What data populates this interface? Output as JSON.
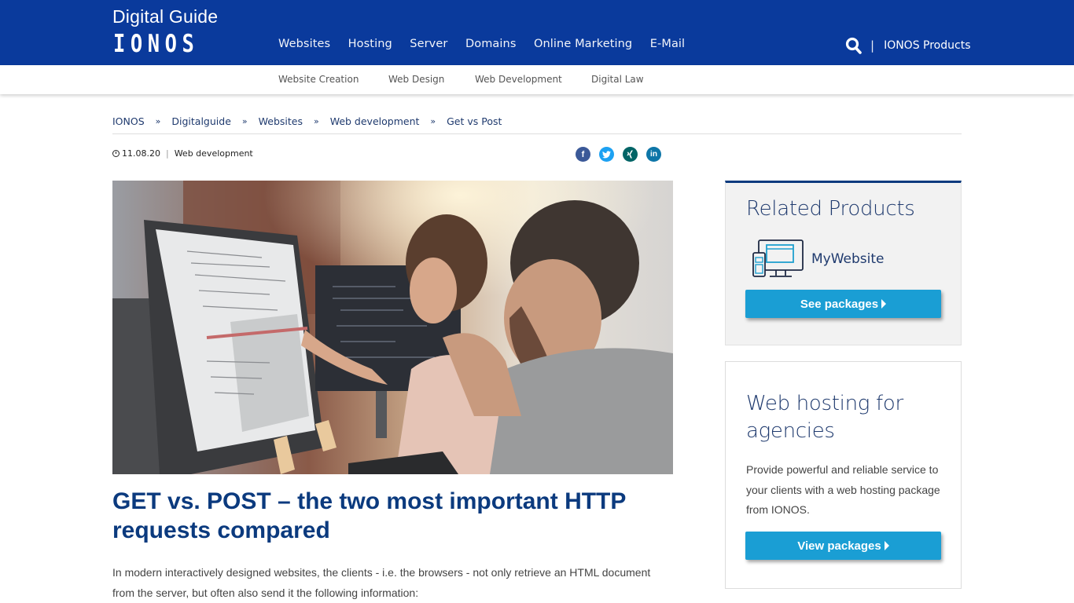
{
  "header": {
    "site_title": "Digital Guide",
    "logo": "IONOS",
    "nav": [
      "Websites",
      "Hosting",
      "Server",
      "Domains",
      "Online Marketing",
      "E-Mail"
    ],
    "search_icon": "search-icon",
    "separator": "|",
    "products_link": "IONOS Products",
    "bg_color": "#0a3a9c"
  },
  "subnav": [
    "Website Creation",
    "Web Design",
    "Web Development",
    "Digital Law"
  ],
  "breadcrumb": {
    "items": [
      "IONOS",
      "Digitalguide",
      "Websites",
      "Web development",
      "Get vs Post"
    ],
    "separator": "»"
  },
  "meta": {
    "date": "11.08.20",
    "separator": "|",
    "category": "Web development"
  },
  "social": [
    {
      "name": "facebook",
      "glyph": "f",
      "color": "#3b5998"
    },
    {
      "name": "twitter",
      "glyph": "t",
      "color": "#1da1f2"
    },
    {
      "name": "xing",
      "glyph": "x",
      "color": "#026466"
    },
    {
      "name": "linkedin",
      "glyph": "in",
      "color": "#0e76a8"
    }
  ],
  "article": {
    "hero_alt": "Two developers looking at code on a monitor",
    "title": "GET vs. POST – the two most important HTTP requests compared",
    "intro": "In modern interactively designed websites, the clients - i.e. the browsers - not only retrieve an HTML document from the server, but often also send it the following information:"
  },
  "sidebar": {
    "related": {
      "title": "Related Products",
      "product_name": "MyWebsite",
      "product_icon": "website-devices-icon",
      "button": "See packages"
    },
    "promo": {
      "title": "Web hosting for agencies",
      "text": "Provide powerful and reliable service to your clients with a web hosting package from IONOS.",
      "button": "View packages"
    },
    "accent_color": "#1a9ed4"
  }
}
